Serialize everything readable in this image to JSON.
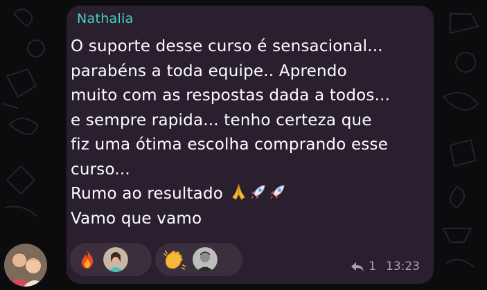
{
  "message": {
    "sender": "Nathalia",
    "lines": [
      "O suporte desse curso é sensacional...",
      "parabéns a toda equipe.. Aprendo",
      "muito com as respostas dada a todos...",
      "e sempre rapida... tenho certeza que",
      "fiz uma ótima escolha comprando esse",
      "curso...",
      "Rumo ao resultado",
      "Vamo que vamo"
    ],
    "emojis_after_line_7": [
      "praying-hands",
      "rocket",
      "rocket"
    ]
  },
  "reactions": [
    {
      "emoji": "fire",
      "count_shown": "avatar"
    },
    {
      "emoji": "clapping-hands",
      "count_shown": "avatar"
    }
  ],
  "meta": {
    "reply_count": "1",
    "time": "13:23"
  },
  "colors": {
    "background": "#0c0b0d",
    "bubble": "#2a1f2f",
    "sender_name": "#45d3bf",
    "text": "#ffffff",
    "reaction_pill": "#3b2f3e",
    "meta_text": "#a9a1ad"
  }
}
